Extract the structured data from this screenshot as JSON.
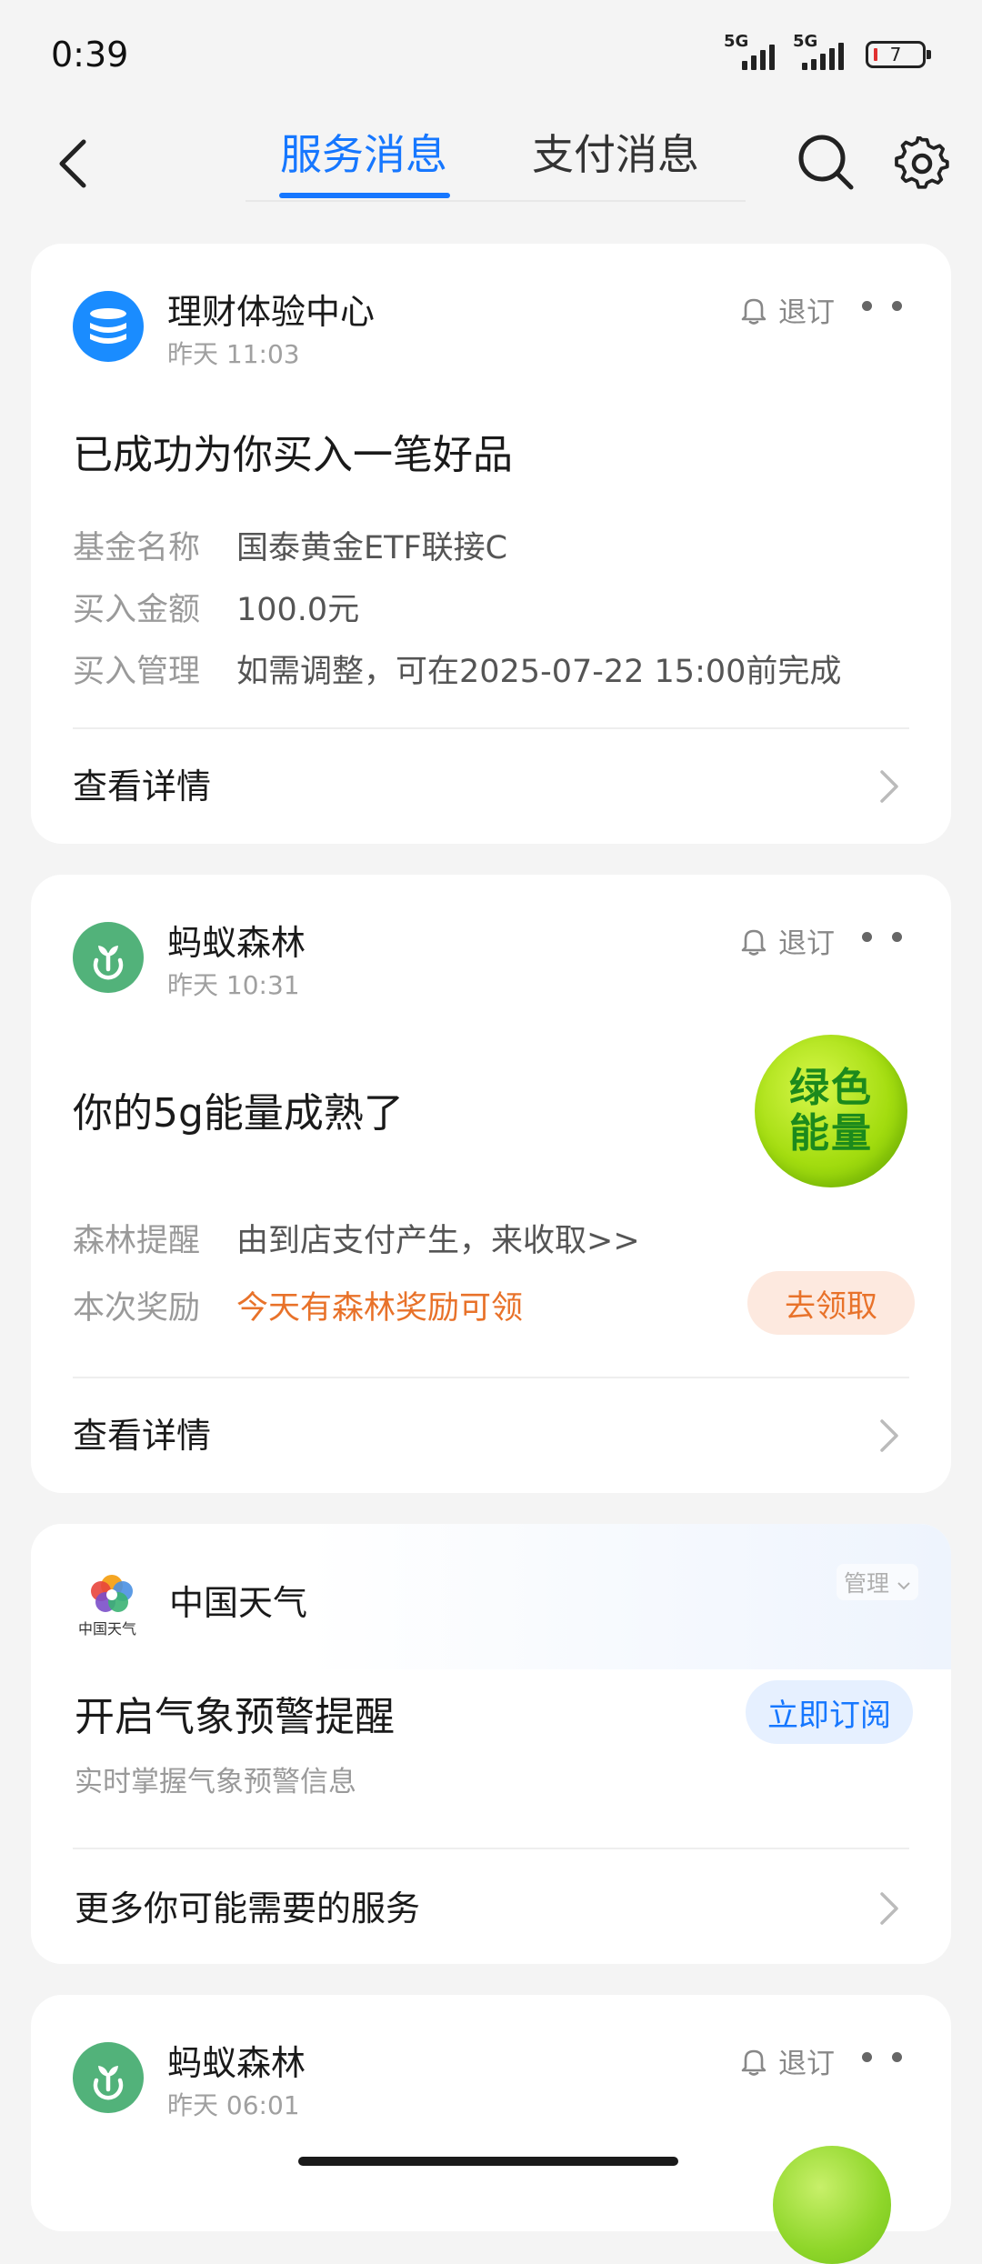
{
  "status_bar": {
    "time": "0:39",
    "signal1_label": "5G",
    "signal2_label": "5G",
    "battery_level": "7"
  },
  "navbar": {
    "tabs": [
      {
        "label": "服务消息",
        "active": true
      },
      {
        "label": "支付消息",
        "active": false
      }
    ]
  },
  "colors": {
    "accent": "#1677ff",
    "orange": "#e8722a",
    "green_avatar": "#52b27a",
    "blue_avatar": "#1a8cff"
  },
  "cards": [
    {
      "source": "理财体验中心",
      "time": "昨天 11:03",
      "unsubscribe": "退订",
      "headline": "已成功为你买入一笔好品",
      "rows": [
        {
          "key": "基金名称",
          "value": "国泰黄金ETF联接C"
        },
        {
          "key": "买入金额",
          "value": "100.0元"
        },
        {
          "key": "买入管理",
          "value": "如需调整，可在2025-07-22 15:00前完成"
        }
      ],
      "link": "查看详情"
    },
    {
      "source": "蚂蚁森林",
      "time": "昨天 10:31",
      "unsubscribe": "退订",
      "headline": "你的5g能量成熟了",
      "badge": "绿色能量",
      "rows": [
        {
          "key": "森林提醒",
          "value": "由到店支付产生，来收取>>"
        },
        {
          "key": "本次奖励",
          "value": "今天有森林奖励可领"
        }
      ],
      "claim_button": "去领取",
      "link": "查看详情"
    },
    {
      "source": "中国天气",
      "logo_text": "中国天气",
      "manage": "管理",
      "headline": "开启气象预警提醒",
      "subtext": "实时掌握气象预警信息",
      "subscribe_button": "立即订阅",
      "link": "更多你可能需要的服务"
    },
    {
      "source": "蚂蚁森林",
      "time": "昨天 06:01",
      "unsubscribe": "退订"
    }
  ]
}
